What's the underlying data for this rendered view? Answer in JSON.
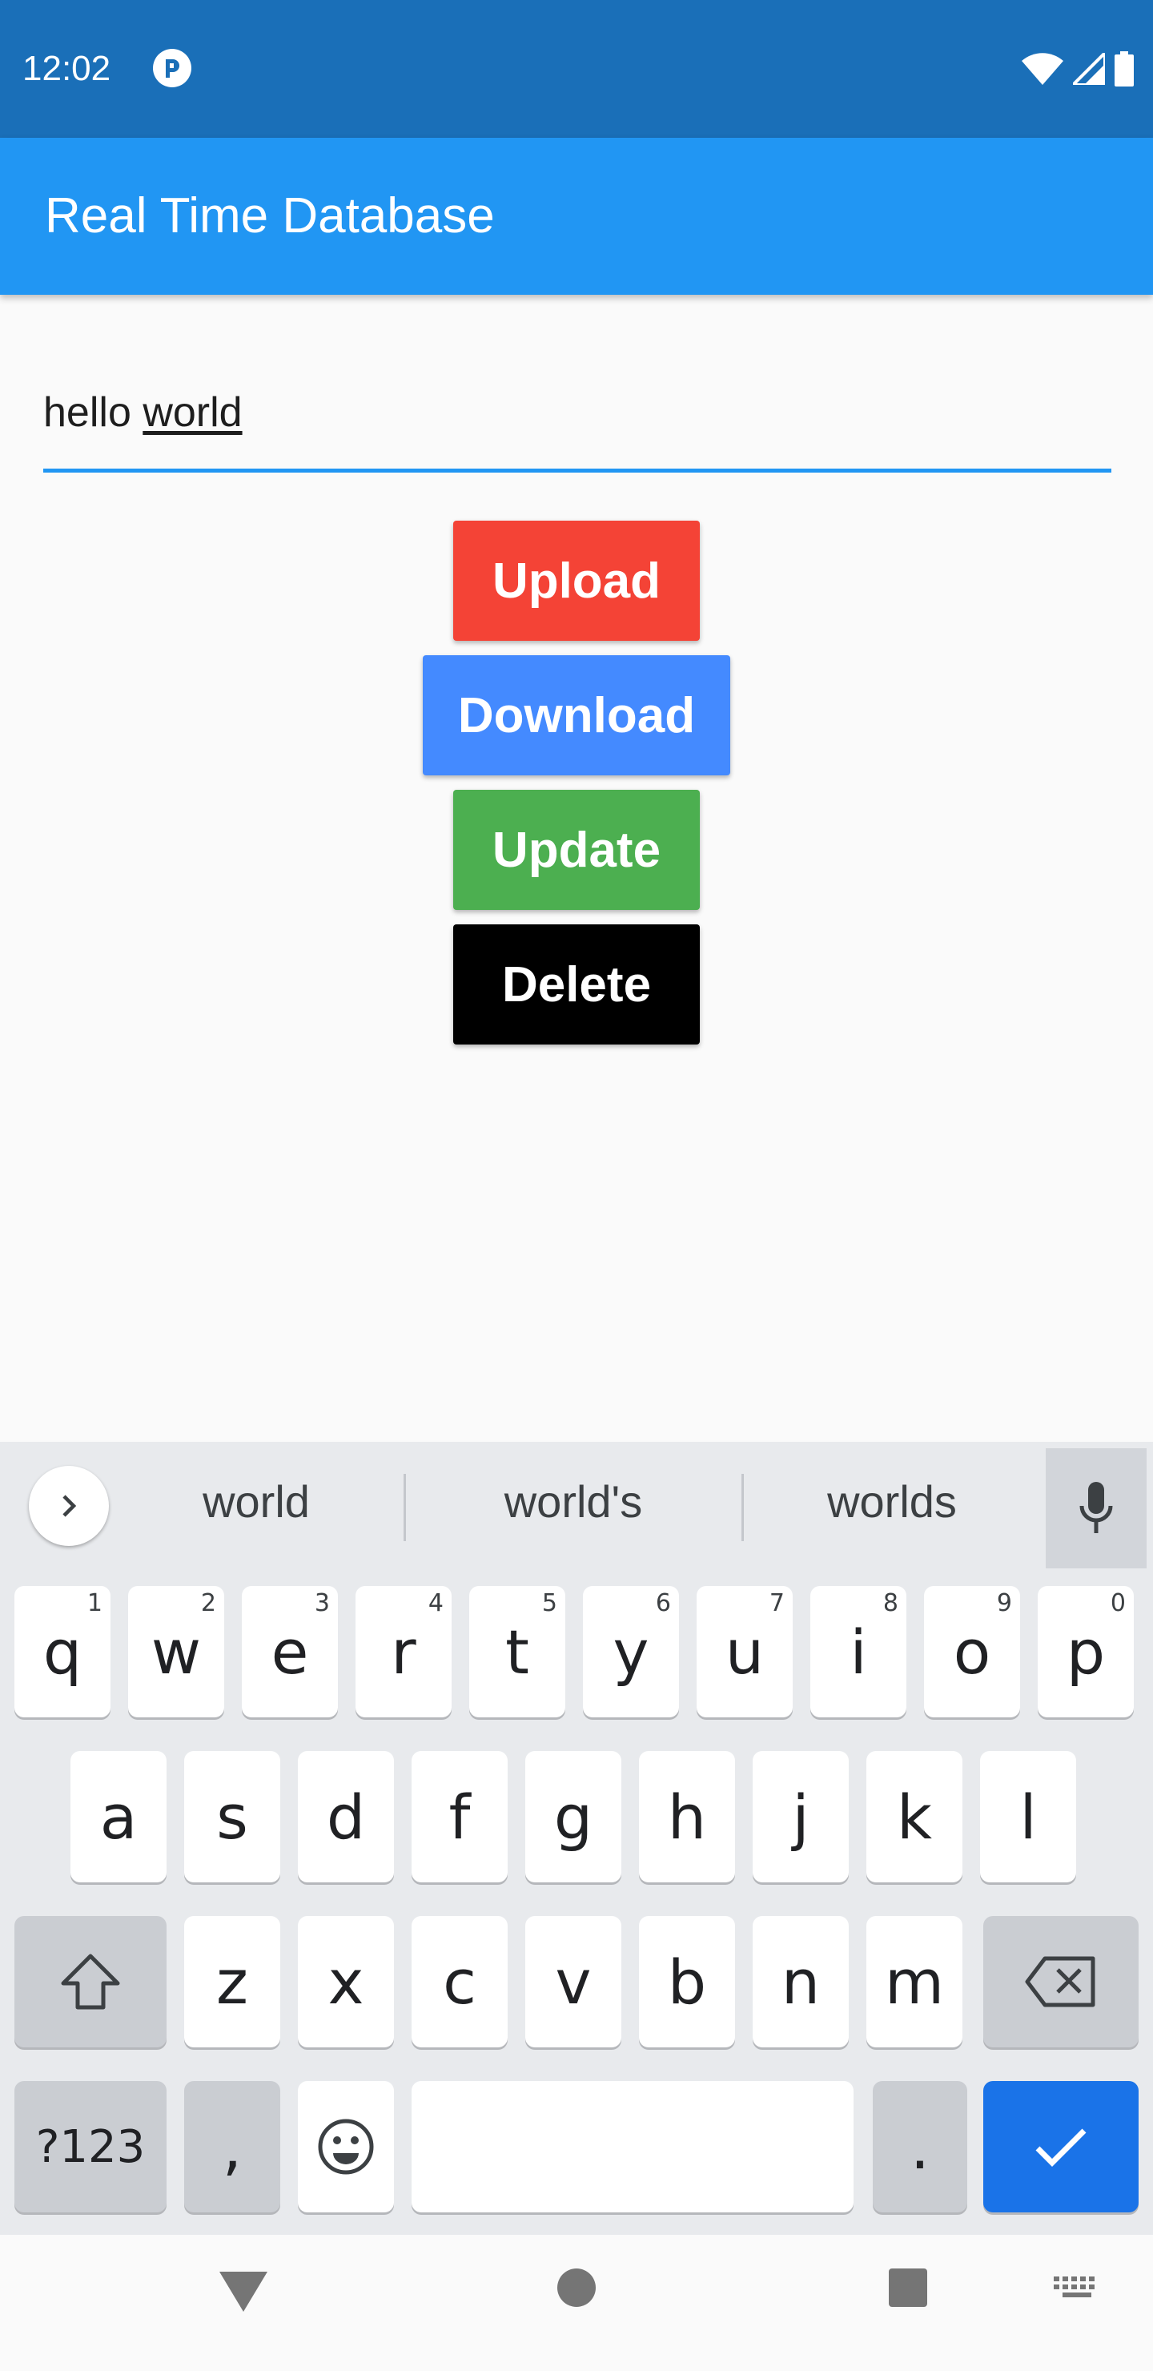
{
  "status_bar": {
    "time": "12:02",
    "app_icon": "pocket-casts-icon",
    "icons": [
      "wifi-icon",
      "signal-icon",
      "battery-icon"
    ]
  },
  "app_bar": {
    "title": "Real Time Database",
    "color": "#2196F3"
  },
  "text_field": {
    "value_plain": "hello ",
    "value_underlined": "world"
  },
  "buttons": {
    "upload": {
      "label": "Upload",
      "color": "#F44336"
    },
    "download": {
      "label": "Download",
      "color": "#448AFF"
    },
    "update": {
      "label": "Update",
      "color": "#4CAF50"
    },
    "delete": {
      "label": "Delete",
      "color": "#000000"
    }
  },
  "keyboard": {
    "suggestions": [
      "world",
      "world's",
      "worlds"
    ],
    "row1": [
      {
        "key": "q",
        "hint": "1"
      },
      {
        "key": "w",
        "hint": "2"
      },
      {
        "key": "e",
        "hint": "3"
      },
      {
        "key": "r",
        "hint": "4"
      },
      {
        "key": "t",
        "hint": "5"
      },
      {
        "key": "y",
        "hint": "6"
      },
      {
        "key": "u",
        "hint": "7"
      },
      {
        "key": "i",
        "hint": "8"
      },
      {
        "key": "o",
        "hint": "9"
      },
      {
        "key": "p",
        "hint": "0"
      }
    ],
    "row2": [
      "a",
      "s",
      "d",
      "f",
      "g",
      "h",
      "j",
      "k",
      "l"
    ],
    "row3": [
      "z",
      "x",
      "c",
      "v",
      "b",
      "n",
      "m"
    ],
    "symbols_label": "?123",
    "comma_label": ",",
    "period_label": ".",
    "icons": [
      "chevron-right-icon",
      "mic-icon",
      "shift-icon",
      "backspace-icon",
      "emoji-icon",
      "checkmark-icon"
    ]
  },
  "nav_bar": {
    "icons": [
      "back-icon",
      "home-icon",
      "recents-icon",
      "keyboard-switch-icon"
    ]
  }
}
